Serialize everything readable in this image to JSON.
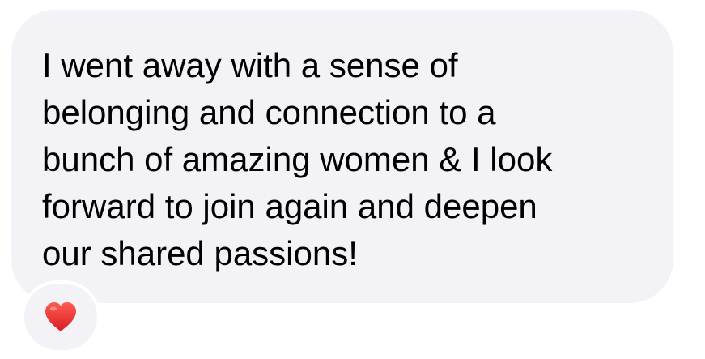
{
  "message": {
    "text": "I went away with a sense of\nbelonging and connection to a\nbunch of amazing women & I look\nforward to join again and deepen\nour shared passions!"
  },
  "reaction": {
    "icon": "red-heart-icon",
    "color": "#e8322e"
  },
  "colors": {
    "bubble_background": "#f2f2f7",
    "text": "#000000"
  }
}
